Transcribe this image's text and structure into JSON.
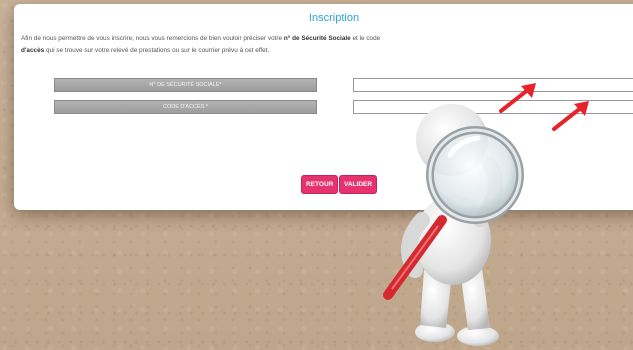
{
  "form": {
    "title": "Inscription",
    "intro_part1": "Afin de nous permettre de vous inscrire, nous vous remercions de bien vouloir préciser votre ",
    "intro_bold1": "n° de Sécurité Sociale",
    "intro_part2": " et le code",
    "intro_bold2": "d'accès",
    "intro_part3": " qui se trouve sur votre relevé de prestations ou sur le courrier prévu à cet effet.",
    "fields": [
      {
        "label": "N° DE SÉCURITÉ SOCIALE*",
        "value": ""
      },
      {
        "label": "CODE D'ACCÈS *",
        "value": ""
      }
    ],
    "buttons": {
      "back": "RETOUR",
      "submit": "VALIDER"
    }
  },
  "colors": {
    "title": "#2fa3d6",
    "button": "#e6336f",
    "arrow": "#e8222b"
  },
  "icons": [
    "red-arrow-icon",
    "magnifying-glass-icon"
  ]
}
